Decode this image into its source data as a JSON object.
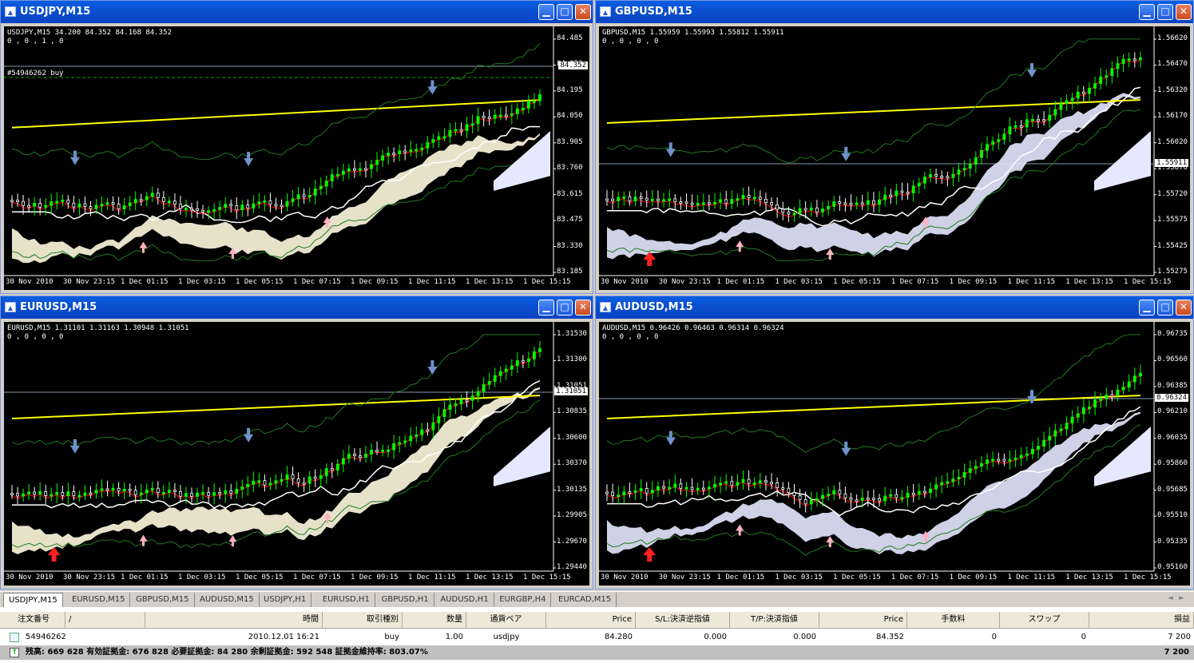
{
  "windows": [
    {
      "title": "USDJPY,M15",
      "info": "USDJPY,M15  34.200 84.352 84.168 84.352",
      "info2": "0 , 0 , 1 , 0",
      "order_label": "#54946262 buy",
      "price_label": "84.352",
      "yticks": [
        "84.485",
        "84.352",
        "84.195",
        "84.050",
        "83.905",
        "83.760",
        "83.615",
        "83.475",
        "83.330",
        "83.185"
      ],
      "xticks": [
        "30 Nov 2010",
        "30 Nov 23:15",
        "1 Dec 01:15",
        "1 Dec 03:15",
        "1 Dec 05:15",
        "1 Dec 07:15",
        "1 Dec 09:15",
        "1 Dec 11:15",
        "1 Dec 13:15",
        "1 Dec 15:15"
      ]
    },
    {
      "title": "GBPUSD,M15",
      "info": "GBPUSD,M15  1.55959 1.55993 1.55812 1.55911",
      "info2": "0 , 0 , 0 , 0",
      "price_label": "1.55911",
      "yticks": [
        "1.56620",
        "1.56470",
        "1.56320",
        "1.56170",
        "1.56020",
        "1.55870",
        "1.55720",
        "1.55575",
        "1.55425",
        "1.55275"
      ],
      "xticks": [
        "30 Nov 2010",
        "30 Nov 23:15",
        "1 Dec 01:15",
        "1 Dec 03:15",
        "1 Dec 05:15",
        "1 Dec 07:15",
        "1 Dec 09:15",
        "1 Dec 11:15",
        "1 Dec 13:15",
        "1 Dec 15:15"
      ]
    },
    {
      "title": "EURUSD,M15",
      "info": "EURUSD,M15  1.31101 1.31163 1.30948 1.31051",
      "info2": "0 , 0 , 0 , 0",
      "price_label": "1.31051",
      "yticks": [
        "1.31530",
        "1.31300",
        "1.31051",
        "1.30835",
        "1.30600",
        "1.30370",
        "1.30135",
        "1.29905",
        "1.29670",
        "1.29440"
      ],
      "xticks": [
        "30 Nov 2010",
        "30 Nov 23:15",
        "1 Dec 01:15",
        "1 Dec 03:15",
        "1 Dec 05:15",
        "1 Dec 07:15",
        "1 Dec 09:15",
        "1 Dec 11:15",
        "1 Dec 13:15",
        "1 Dec 15:15"
      ]
    },
    {
      "title": "AUDUSD,M15",
      "info": "AUDUSD,M15  0.96426 0.96463 0.96314 0.96324",
      "info2": "0 , 0 , 0 , 0",
      "price_label": "0.96324",
      "yticks": [
        "0.96735",
        "0.96560",
        "0.96385",
        "0.96210",
        "0.96035",
        "0.95860",
        "0.95685",
        "0.95510",
        "0.95335",
        "0.95160"
      ],
      "xticks": [
        "30 Nov 2010",
        "30 Nov 23:15",
        "1 Dec 01:15",
        "1 Dec 03:15",
        "1 Dec 05:15",
        "1 Dec 07:15",
        "1 Dec 09:15",
        "1 Dec 11:15",
        "1 Dec 13:15",
        "1 Dec 15:15"
      ]
    }
  ],
  "tabs": [
    "USDJPY,M15",
    "EURUSD,M15",
    "GBPUSD,M15",
    "AUDUSD,M15",
    "USDJPY,H1",
    "EURUSD,H1",
    "GBPUSD,H1",
    "AUDUSD,H1",
    "EURGBP,H4",
    "EURCAD,M15"
  ],
  "terminal": {
    "headers": [
      "注文番号",
      "/",
      "時間",
      "取引種別",
      "数量",
      "通貨ペア",
      "Price",
      "S/L:決済逆指値",
      "T/P:決済指値",
      "Price",
      "手数料",
      "スワップ",
      "損益"
    ],
    "row": [
      "54946262",
      "2010.12.01 16:21",
      "buy",
      "1.00",
      "usdjpy",
      "84.280",
      "0.000",
      "0.000",
      "84.352",
      "0",
      "0",
      "7 200"
    ],
    "balance": "残高: 669 628   有効証拠金: 676 828   必要証拠金: 84 280   余剰証拠金: 592 548   証拠金維持率: 803.07%",
    "balance_pl": "7 200"
  },
  "colors": {
    "title_bar": "#0b4fd1",
    "candle_up": "#00ff00",
    "candle_down": "#ffffff",
    "ma_yellow": "#ffff00",
    "ma_red": "#ff0000",
    "cloud_light": "#fffbe0",
    "cloud_blue": "#e6e8ff",
    "arrow_down": "#6f93c9",
    "arrow_up": "#ffb0c0"
  }
}
